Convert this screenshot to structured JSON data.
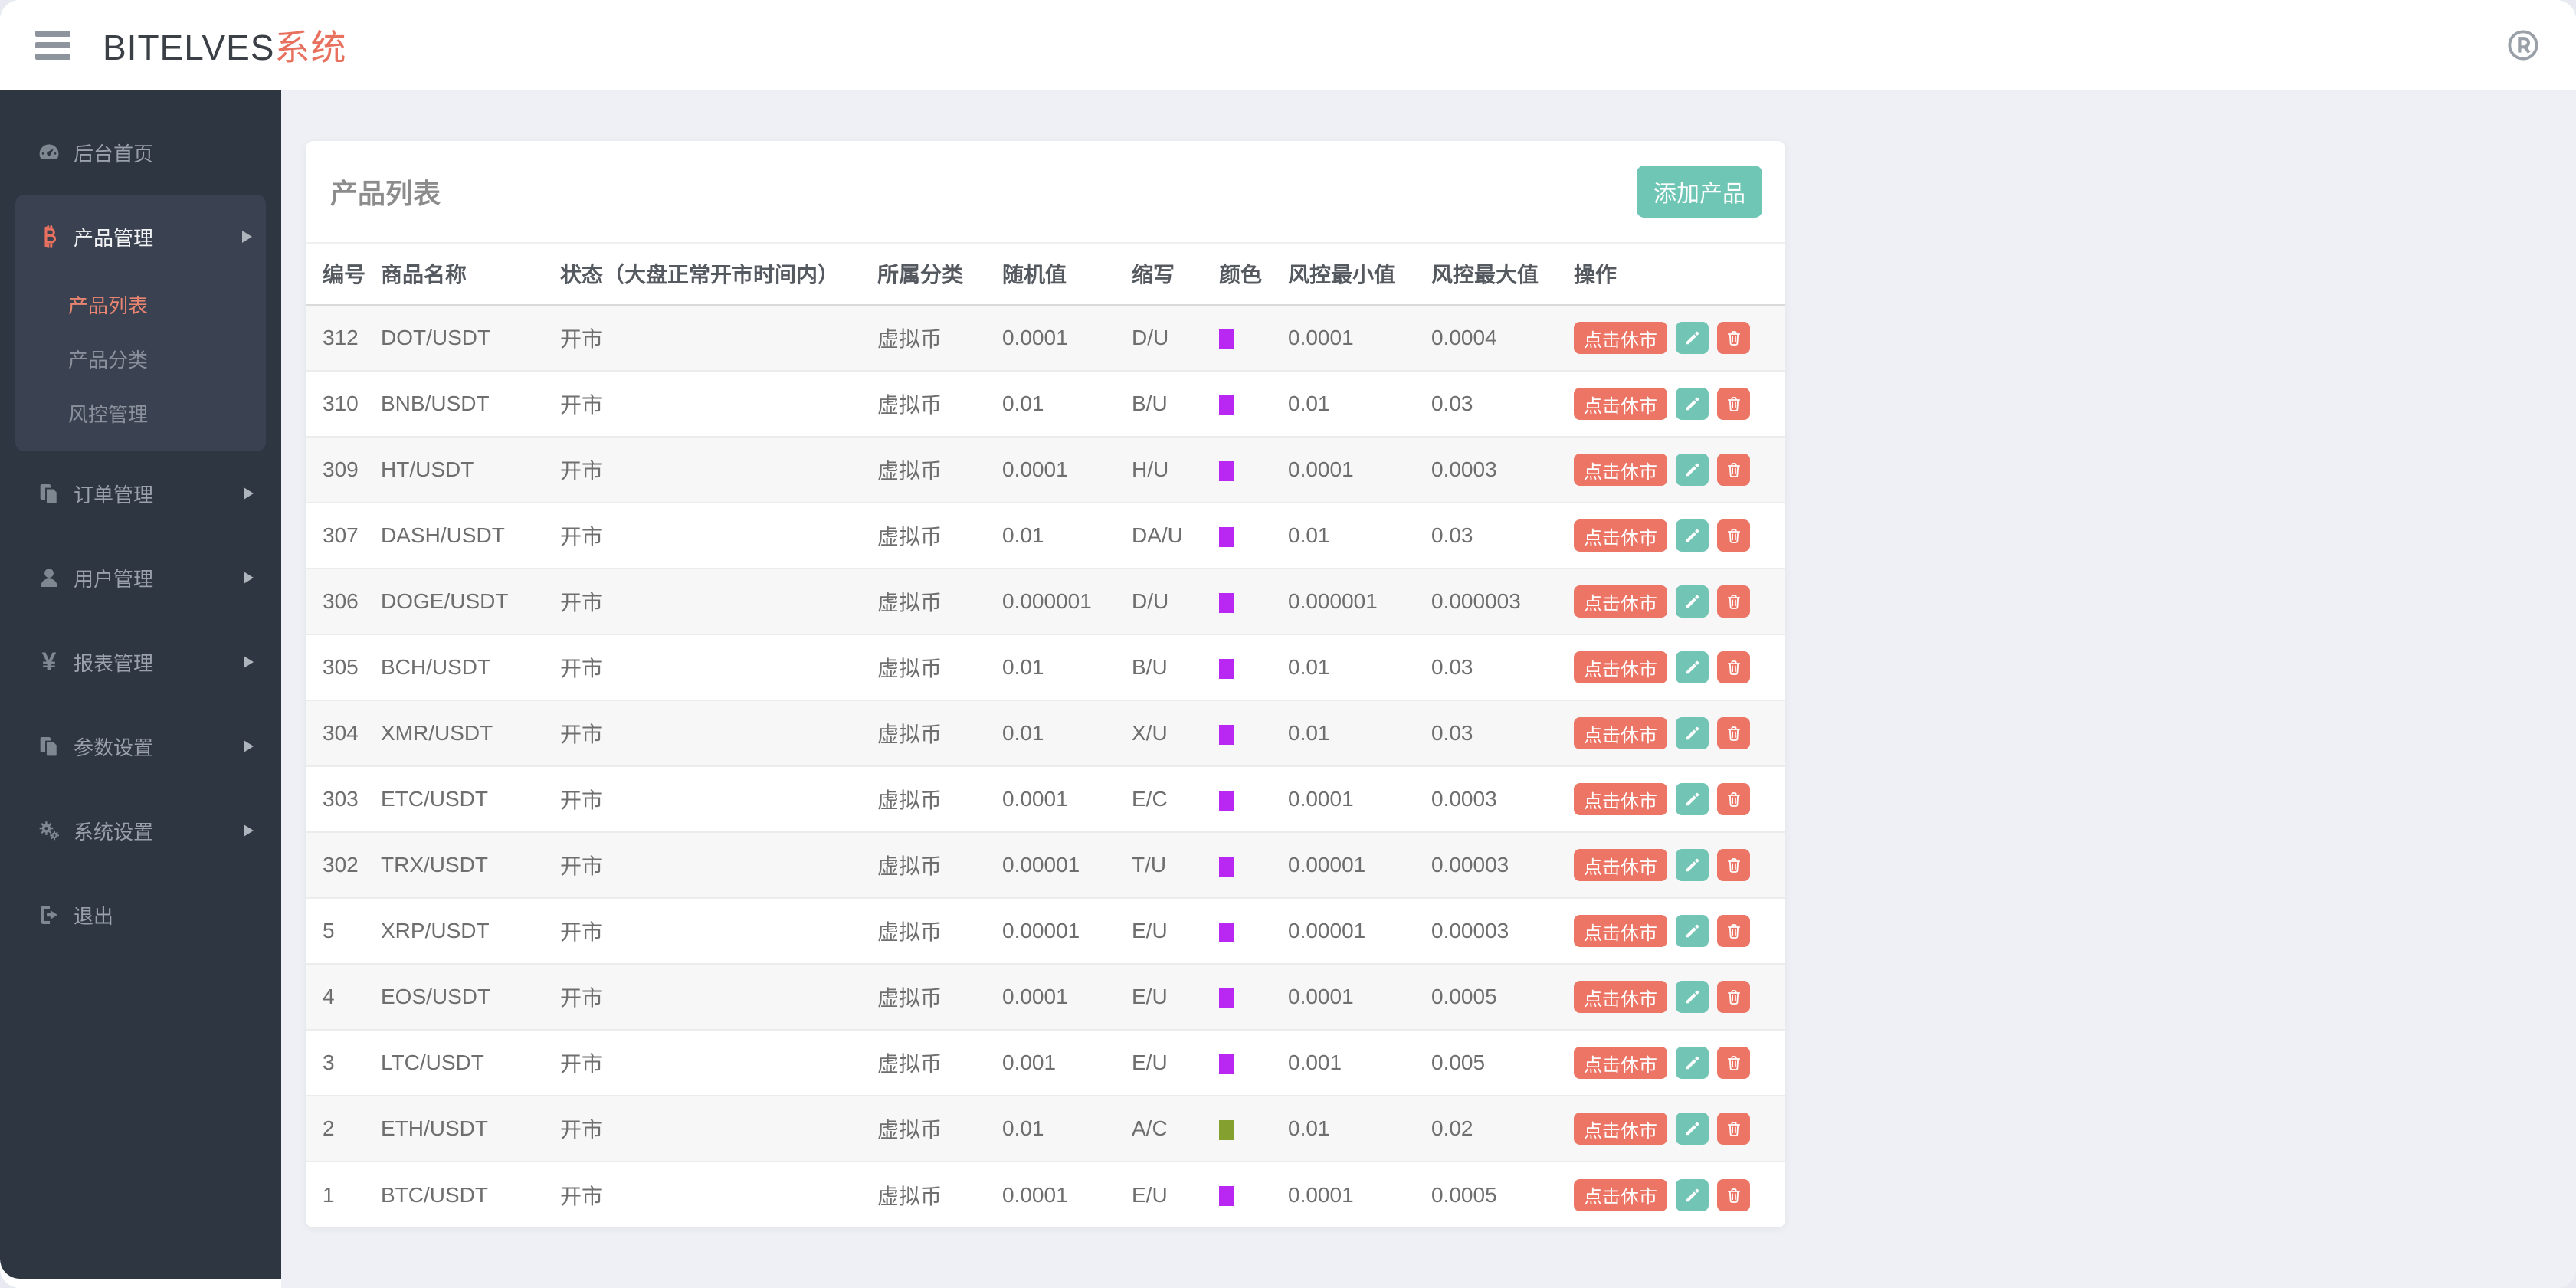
{
  "topbar": {
    "brand_main": "BITELVES",
    "brand_accent": "系统",
    "right_icon": "registered-icon"
  },
  "sidebar": {
    "items": [
      {
        "label": "后台首页",
        "icon": "dashboard-icon",
        "arrow": false
      },
      {
        "label": "产品管理",
        "icon": "bitcoin-icon",
        "arrow": true,
        "expanded": true,
        "children": [
          {
            "label": "产品列表",
            "active": true
          },
          {
            "label": "产品分类",
            "active": false
          },
          {
            "label": "风控管理",
            "active": false
          }
        ]
      },
      {
        "label": "订单管理",
        "icon": "files-icon",
        "arrow": true
      },
      {
        "label": "用户管理",
        "icon": "user-icon",
        "arrow": true
      },
      {
        "label": "报表管理",
        "icon": "yen-icon",
        "arrow": true,
        "yen_glyph": "¥"
      },
      {
        "label": "参数设置",
        "icon": "files-icon",
        "arrow": true
      },
      {
        "label": "系统设置",
        "icon": "gears-icon",
        "arrow": true
      },
      {
        "label": "退出",
        "icon": "logout-icon",
        "arrow": false
      }
    ]
  },
  "main": {
    "card_title": "产品列表",
    "add_button": "添加产品",
    "table": {
      "headers": [
        "编号",
        "商品名称",
        "状态（大盘正常开市时间内）",
        "所属分类",
        "随机值",
        "缩写",
        "颜色",
        "风控最小值",
        "风控最大值",
        "操作"
      ],
      "actions": {
        "toggle": "点击休市",
        "edit": "edit-pencil-icon",
        "delete": "trash-icon"
      },
      "rows": [
        {
          "id": "312",
          "name": "DOT/USDT",
          "status": "开市",
          "category": "虚拟币",
          "random": "0.0001",
          "abbr": "D/U",
          "color": "#b927f2",
          "min": "0.0001",
          "max": "0.0004"
        },
        {
          "id": "310",
          "name": "BNB/USDT",
          "status": "开市",
          "category": "虚拟币",
          "random": "0.01",
          "abbr": "B/U",
          "color": "#b927f2",
          "min": "0.01",
          "max": "0.03"
        },
        {
          "id": "309",
          "name": "HT/USDT",
          "status": "开市",
          "category": "虚拟币",
          "random": "0.0001",
          "abbr": "H/U",
          "color": "#b927f2",
          "min": "0.0001",
          "max": "0.0003"
        },
        {
          "id": "307",
          "name": "DASH/USDT",
          "status": "开市",
          "category": "虚拟币",
          "random": "0.01",
          "abbr": "DA/U",
          "color": "#b927f2",
          "min": "0.01",
          "max": "0.03"
        },
        {
          "id": "306",
          "name": "DOGE/USDT",
          "status": "开市",
          "category": "虚拟币",
          "random": "0.000001",
          "abbr": "D/U",
          "color": "#b927f2",
          "min": "0.000001",
          "max": "0.000003"
        },
        {
          "id": "305",
          "name": "BCH/USDT",
          "status": "开市",
          "category": "虚拟币",
          "random": "0.01",
          "abbr": "B/U",
          "color": "#b927f2",
          "min": "0.01",
          "max": "0.03"
        },
        {
          "id": "304",
          "name": "XMR/USDT",
          "status": "开市",
          "category": "虚拟币",
          "random": "0.01",
          "abbr": "X/U",
          "color": "#b927f2",
          "min": "0.01",
          "max": "0.03"
        },
        {
          "id": "303",
          "name": "ETC/USDT",
          "status": "开市",
          "category": "虚拟币",
          "random": "0.0001",
          "abbr": "E/C",
          "color": "#b927f2",
          "min": "0.0001",
          "max": "0.0003"
        },
        {
          "id": "302",
          "name": "TRX/USDT",
          "status": "开市",
          "category": "虚拟币",
          "random": "0.00001",
          "abbr": "T/U",
          "color": "#b927f2",
          "min": "0.00001",
          "max": "0.00003"
        },
        {
          "id": "5",
          "name": "XRP/USDT",
          "status": "开市",
          "category": "虚拟币",
          "random": "0.00001",
          "abbr": "E/U",
          "color": "#b927f2",
          "min": "0.00001",
          "max": "0.00003"
        },
        {
          "id": "4",
          "name": "EOS/USDT",
          "status": "开市",
          "category": "虚拟币",
          "random": "0.0001",
          "abbr": "E/U",
          "color": "#b927f2",
          "min": "0.0001",
          "max": "0.0005"
        },
        {
          "id": "3",
          "name": "LTC/USDT",
          "status": "开市",
          "category": "虚拟币",
          "random": "0.001",
          "abbr": "E/U",
          "color": "#b927f2",
          "min": "0.001",
          "max": "0.005"
        },
        {
          "id": "2",
          "name": "ETH/USDT",
          "status": "开市",
          "category": "虚拟币",
          "random": "0.01",
          "abbr": "A/C",
          "color": "#84a02f",
          "min": "0.01",
          "max": "0.02"
        },
        {
          "id": "1",
          "name": "BTC/USDT",
          "status": "开市",
          "category": "虚拟币",
          "random": "0.0001",
          "abbr": "E/U",
          "color": "#b927f2",
          "min": "0.0001",
          "max": "0.0005"
        }
      ]
    }
  },
  "colors": {
    "accent_red": "#ec7565",
    "accent_teal": "#70c6b4",
    "brand_accent": "#e8705f",
    "sidebar_bg": "#2e3642",
    "sidebar_group_bg": "#3a4150",
    "content_bg": "#eef0f5",
    "chip_purple": "#b927f2",
    "chip_olive": "#84a02f"
  }
}
